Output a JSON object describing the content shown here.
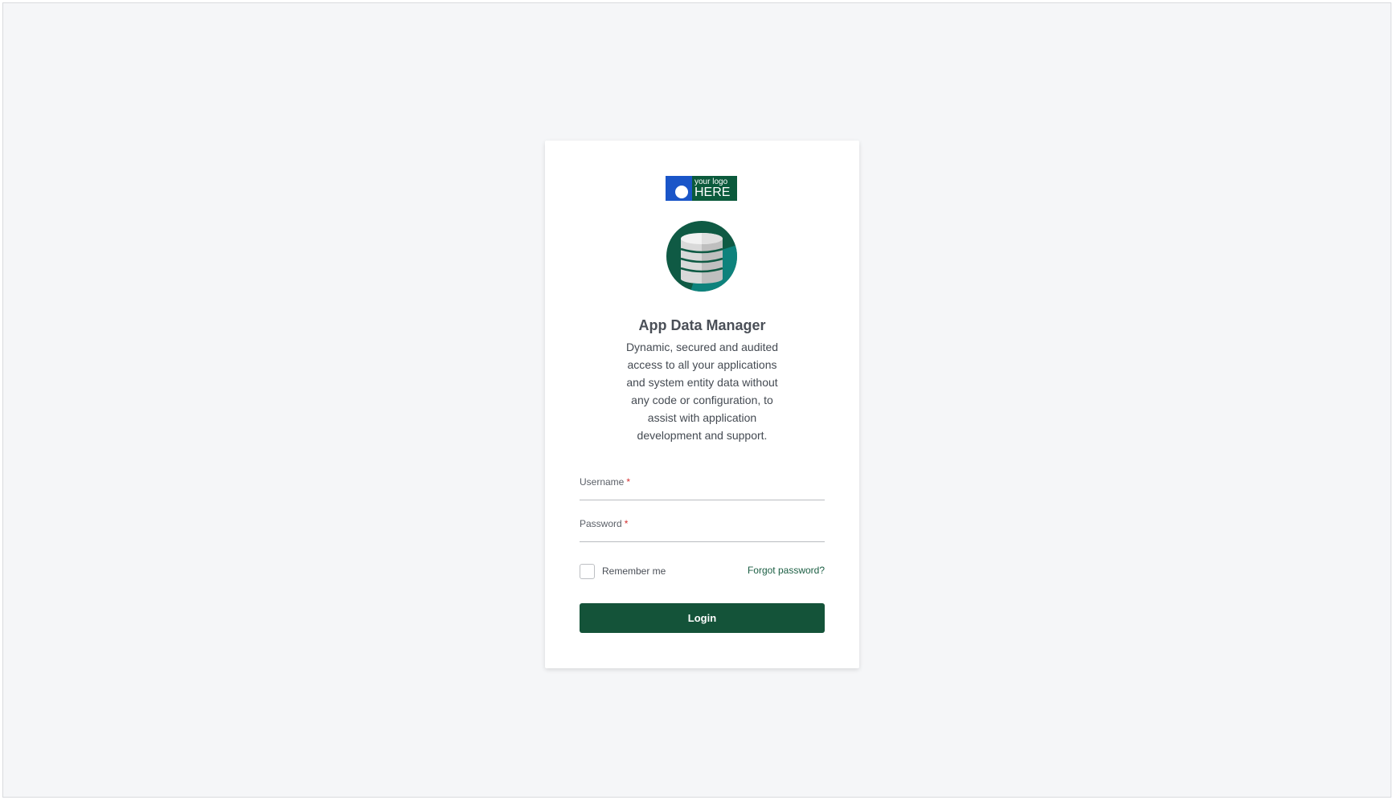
{
  "logo": {
    "line1": "your logo",
    "line2": "HERE"
  },
  "app": {
    "title": "App Data Manager",
    "description": "Dynamic, secured and audited access to all your applications and system entity data without any code or configuration, to assist with application development and support.",
    "icon": "database-icon"
  },
  "form": {
    "username_label": "Username",
    "password_label": "Password",
    "required_marker": "*",
    "username_value": "",
    "password_value": "",
    "remember_label": "Remember me",
    "remember_checked": false,
    "forgot_label": "Forgot password?",
    "login_label": "Login"
  },
  "colors": {
    "background": "#f5f6f8",
    "card": "#ffffff",
    "primary": "#145339",
    "link": "#1b5e43",
    "required": "#d32f2f",
    "icon_circle": "#0f5a44",
    "icon_circle_shade": "#0e8a86",
    "logo_background": "#0b5a3c",
    "logo_accent": "#1a55c8"
  }
}
